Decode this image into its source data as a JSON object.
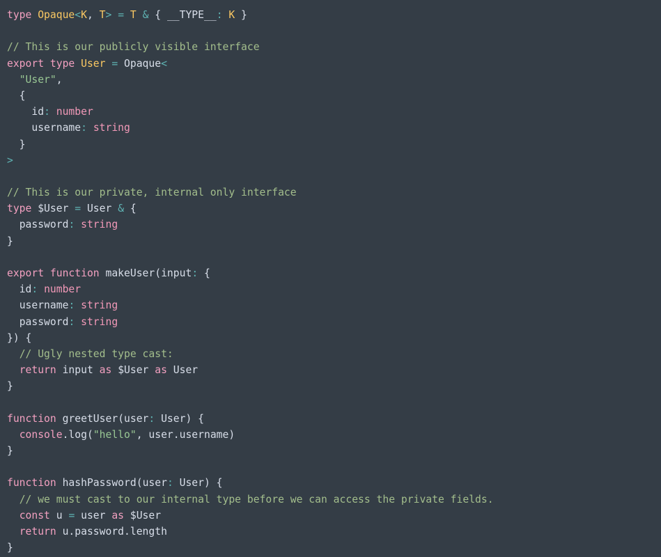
{
  "editor": {
    "language": "typescript",
    "theme": "oceanic-next-dark",
    "background_color": "#343d46",
    "default_text_color": "#d8dee9",
    "token_colors": {
      "keyword": "#f2a0c0",
      "type": "#fac863",
      "operator": "#5fb3b3",
      "string": "#99c794",
      "comment": "#a3be8c",
      "primitive": "#f299b8",
      "identifier": "#d8dee9"
    }
  },
  "lines": [
    {
      "n": 1,
      "text": "type Opaque<K, T> = T & { __TYPE__: K }"
    },
    {
      "n": 2,
      "text": ""
    },
    {
      "n": 3,
      "text": "// This is our publicly visible interface"
    },
    {
      "n": 4,
      "text": "export type User = Opaque<"
    },
    {
      "n": 5,
      "text": "  \"User\","
    },
    {
      "n": 6,
      "text": "  {"
    },
    {
      "n": 7,
      "text": "    id: number"
    },
    {
      "n": 8,
      "text": "    username: string"
    },
    {
      "n": 9,
      "text": "  }"
    },
    {
      "n": 10,
      "text": ">"
    },
    {
      "n": 11,
      "text": ""
    },
    {
      "n": 12,
      "text": "// This is our private, internal only interface"
    },
    {
      "n": 13,
      "text": "type $User = User & {"
    },
    {
      "n": 14,
      "text": "  password: string"
    },
    {
      "n": 15,
      "text": "}"
    },
    {
      "n": 16,
      "text": ""
    },
    {
      "n": 17,
      "text": "export function makeUser(input: {"
    },
    {
      "n": 18,
      "text": "  id: number"
    },
    {
      "n": 19,
      "text": "  username: string"
    },
    {
      "n": 20,
      "text": "  password: string"
    },
    {
      "n": 21,
      "text": "}) {"
    },
    {
      "n": 22,
      "text": "  // Ugly nested type cast:"
    },
    {
      "n": 23,
      "text": "  return input as $User as User"
    },
    {
      "n": 24,
      "text": "}"
    },
    {
      "n": 25,
      "text": ""
    },
    {
      "n": 26,
      "text": "function greetUser(user: User) {"
    },
    {
      "n": 27,
      "text": "  console.log(\"hello\", user.username)"
    },
    {
      "n": 28,
      "text": "}"
    },
    {
      "n": 29,
      "text": ""
    },
    {
      "n": 30,
      "text": "function hashPassword(user: User) {"
    },
    {
      "n": 31,
      "text": "  // we must cast to our internal type before we can access the private fields."
    },
    {
      "n": 32,
      "text": "  const u = user as $User"
    },
    {
      "n": 33,
      "text": "  return u.password.length"
    },
    {
      "n": 34,
      "text": "}"
    }
  ],
  "tokens": [
    [
      {
        "t": "type",
        "c": "kw"
      },
      {
        "t": " ",
        "c": "id"
      },
      {
        "t": "Opaque",
        "c": "type"
      },
      {
        "t": "<",
        "c": "op"
      },
      {
        "t": "K",
        "c": "type"
      },
      {
        "t": ", ",
        "c": "id"
      },
      {
        "t": "T",
        "c": "type"
      },
      {
        "t": ">",
        "c": "op"
      },
      {
        "t": " ",
        "c": "id"
      },
      {
        "t": "=",
        "c": "op"
      },
      {
        "t": " ",
        "c": "id"
      },
      {
        "t": "T",
        "c": "type"
      },
      {
        "t": " ",
        "c": "id"
      },
      {
        "t": "&",
        "c": "op"
      },
      {
        "t": " { ",
        "c": "id"
      },
      {
        "t": "__TYPE__",
        "c": "id"
      },
      {
        "t": ":",
        "c": "op"
      },
      {
        "t": " ",
        "c": "id"
      },
      {
        "t": "K",
        "c": "type"
      },
      {
        "t": " }",
        "c": "id"
      }
    ],
    [],
    [
      {
        "t": "// This is our publicly visible interface",
        "c": "com"
      }
    ],
    [
      {
        "t": "export",
        "c": "kw"
      },
      {
        "t": " ",
        "c": "id"
      },
      {
        "t": "type",
        "c": "kw"
      },
      {
        "t": " ",
        "c": "id"
      },
      {
        "t": "User",
        "c": "type"
      },
      {
        "t": " ",
        "c": "id"
      },
      {
        "t": "=",
        "c": "op"
      },
      {
        "t": " ",
        "c": "id"
      },
      {
        "t": "Opaque",
        "c": "id"
      },
      {
        "t": "<",
        "c": "op"
      }
    ],
    [
      {
        "t": "  ",
        "c": "id"
      },
      {
        "t": "\"User\"",
        "c": "str"
      },
      {
        "t": ",",
        "c": "id"
      }
    ],
    [
      {
        "t": "  {",
        "c": "id"
      }
    ],
    [
      {
        "t": "    ",
        "c": "id"
      },
      {
        "t": "id",
        "c": "id"
      },
      {
        "t": ":",
        "c": "op"
      },
      {
        "t": " ",
        "c": "id"
      },
      {
        "t": "number",
        "c": "prim"
      }
    ],
    [
      {
        "t": "    ",
        "c": "id"
      },
      {
        "t": "username",
        "c": "id"
      },
      {
        "t": ":",
        "c": "op"
      },
      {
        "t": " ",
        "c": "id"
      },
      {
        "t": "string",
        "c": "prim"
      }
    ],
    [
      {
        "t": "  }",
        "c": "id"
      }
    ],
    [
      {
        "t": ">",
        "c": "op"
      }
    ],
    [],
    [
      {
        "t": "// This is our private, internal only interface",
        "c": "com"
      }
    ],
    [
      {
        "t": "type",
        "c": "kw"
      },
      {
        "t": " ",
        "c": "id"
      },
      {
        "t": "$User",
        "c": "id"
      },
      {
        "t": " ",
        "c": "id"
      },
      {
        "t": "=",
        "c": "op"
      },
      {
        "t": " ",
        "c": "id"
      },
      {
        "t": "User",
        "c": "id"
      },
      {
        "t": " ",
        "c": "id"
      },
      {
        "t": "&",
        "c": "op"
      },
      {
        "t": " {",
        "c": "id"
      }
    ],
    [
      {
        "t": "  ",
        "c": "id"
      },
      {
        "t": "password",
        "c": "id"
      },
      {
        "t": ":",
        "c": "op"
      },
      {
        "t": " ",
        "c": "id"
      },
      {
        "t": "string",
        "c": "prim"
      }
    ],
    [
      {
        "t": "}",
        "c": "id"
      }
    ],
    [],
    [
      {
        "t": "export",
        "c": "kw"
      },
      {
        "t": " ",
        "c": "id"
      },
      {
        "t": "function",
        "c": "kw"
      },
      {
        "t": " ",
        "c": "id"
      },
      {
        "t": "makeUser",
        "c": "fn"
      },
      {
        "t": "(",
        "c": "id"
      },
      {
        "t": "input",
        "c": "id"
      },
      {
        "t": ":",
        "c": "op"
      },
      {
        "t": " {",
        "c": "id"
      }
    ],
    [
      {
        "t": "  ",
        "c": "id"
      },
      {
        "t": "id",
        "c": "id"
      },
      {
        "t": ":",
        "c": "op"
      },
      {
        "t": " ",
        "c": "id"
      },
      {
        "t": "number",
        "c": "prim"
      }
    ],
    [
      {
        "t": "  ",
        "c": "id"
      },
      {
        "t": "username",
        "c": "id"
      },
      {
        "t": ":",
        "c": "op"
      },
      {
        "t": " ",
        "c": "id"
      },
      {
        "t": "string",
        "c": "prim"
      }
    ],
    [
      {
        "t": "  ",
        "c": "id"
      },
      {
        "t": "password",
        "c": "id"
      },
      {
        "t": ":",
        "c": "op"
      },
      {
        "t": " ",
        "c": "id"
      },
      {
        "t": "string",
        "c": "prim"
      }
    ],
    [
      {
        "t": "}) {",
        "c": "id"
      }
    ],
    [
      {
        "t": "  ",
        "c": "id"
      },
      {
        "t": "// Ugly nested type cast:",
        "c": "com"
      }
    ],
    [
      {
        "t": "  ",
        "c": "id"
      },
      {
        "t": "return",
        "c": "kw"
      },
      {
        "t": " ",
        "c": "id"
      },
      {
        "t": "input",
        "c": "id"
      },
      {
        "t": " ",
        "c": "id"
      },
      {
        "t": "as",
        "c": "kw"
      },
      {
        "t": " ",
        "c": "id"
      },
      {
        "t": "$User",
        "c": "id"
      },
      {
        "t": " ",
        "c": "id"
      },
      {
        "t": "as",
        "c": "kw"
      },
      {
        "t": " ",
        "c": "id"
      },
      {
        "t": "User",
        "c": "id"
      }
    ],
    [
      {
        "t": "}",
        "c": "id"
      }
    ],
    [],
    [
      {
        "t": "function",
        "c": "kw"
      },
      {
        "t": " ",
        "c": "id"
      },
      {
        "t": "greetUser",
        "c": "fn"
      },
      {
        "t": "(",
        "c": "id"
      },
      {
        "t": "user",
        "c": "id"
      },
      {
        "t": ":",
        "c": "op"
      },
      {
        "t": " ",
        "c": "id"
      },
      {
        "t": "User",
        "c": "id"
      },
      {
        "t": ") {",
        "c": "id"
      }
    ],
    [
      {
        "t": "  ",
        "c": "id"
      },
      {
        "t": "console",
        "c": "kw"
      },
      {
        "t": ".log(",
        "c": "id"
      },
      {
        "t": "\"hello\"",
        "c": "str"
      },
      {
        "t": ", ",
        "c": "id"
      },
      {
        "t": "user.username",
        "c": "id"
      },
      {
        "t": ")",
        "c": "id"
      }
    ],
    [
      {
        "t": "}",
        "c": "id"
      }
    ],
    [],
    [
      {
        "t": "function",
        "c": "kw"
      },
      {
        "t": " ",
        "c": "id"
      },
      {
        "t": "hashPassword",
        "c": "fn"
      },
      {
        "t": "(",
        "c": "id"
      },
      {
        "t": "user",
        "c": "id"
      },
      {
        "t": ":",
        "c": "op"
      },
      {
        "t": " ",
        "c": "id"
      },
      {
        "t": "User",
        "c": "id"
      },
      {
        "t": ") {",
        "c": "id"
      }
    ],
    [
      {
        "t": "  ",
        "c": "id"
      },
      {
        "t": "// we must cast to our internal type before we can access the private fields.",
        "c": "com"
      }
    ],
    [
      {
        "t": "  ",
        "c": "id"
      },
      {
        "t": "const",
        "c": "kw"
      },
      {
        "t": " ",
        "c": "id"
      },
      {
        "t": "u",
        "c": "id"
      },
      {
        "t": " ",
        "c": "id"
      },
      {
        "t": "=",
        "c": "op"
      },
      {
        "t": " ",
        "c": "id"
      },
      {
        "t": "user",
        "c": "id"
      },
      {
        "t": " ",
        "c": "id"
      },
      {
        "t": "as",
        "c": "kw"
      },
      {
        "t": " ",
        "c": "id"
      },
      {
        "t": "$User",
        "c": "id"
      }
    ],
    [
      {
        "t": "  ",
        "c": "id"
      },
      {
        "t": "return",
        "c": "kw"
      },
      {
        "t": " ",
        "c": "id"
      },
      {
        "t": "u.password.length",
        "c": "id"
      }
    ],
    [
      {
        "t": "}",
        "c": "id"
      }
    ]
  ]
}
